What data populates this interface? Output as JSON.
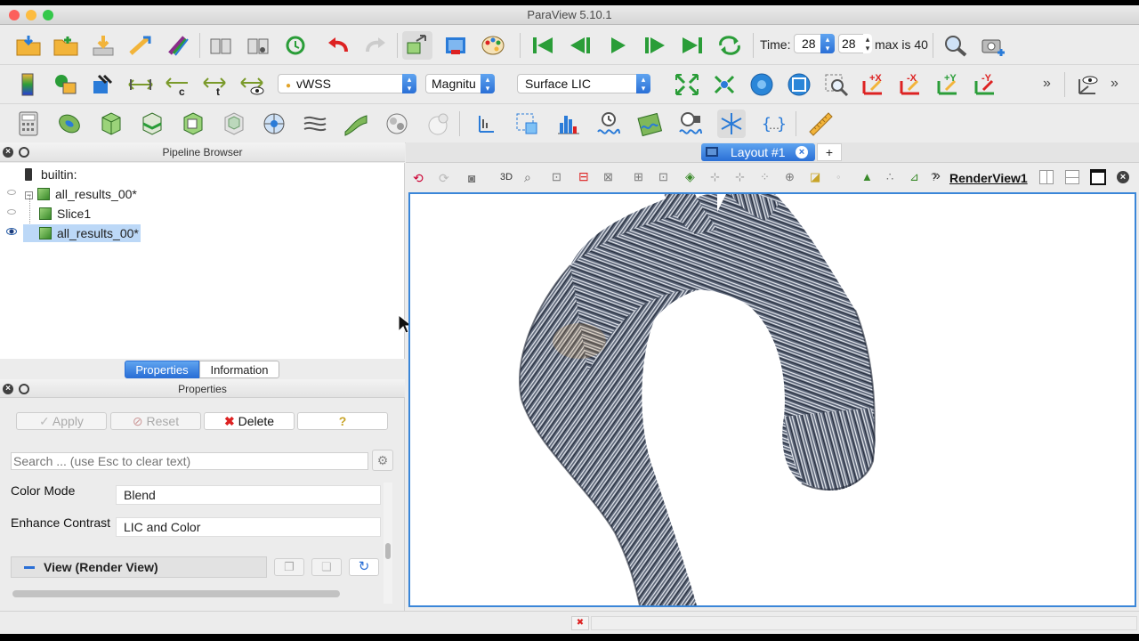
{
  "window": {
    "title": "ParaView 5.10.1"
  },
  "toolbar_top": {
    "time_label": "Time:",
    "time_value": "28",
    "time_index": "28",
    "max_label": "max is 40"
  },
  "toolbar_mid": {
    "array_select": "vWSS",
    "component_select": "Magnitu",
    "representation_select": "Surface LIC",
    "axis_labels": [
      "+X",
      "-X",
      "+Y",
      "-Y"
    ]
  },
  "pipeline": {
    "title": "Pipeline Browser",
    "items": [
      {
        "label": "builtin:"
      },
      {
        "label": "all_results_00*"
      },
      {
        "label": "Slice1"
      },
      {
        "label": "all_results_00*"
      }
    ]
  },
  "tabs": {
    "properties": "Properties",
    "information": "Information"
  },
  "properties": {
    "title": "Properties",
    "apply": "Apply",
    "reset": "Reset",
    "delete": "Delete",
    "help": "?",
    "search_placeholder": "Search ... (use Esc to clear text)",
    "color_mode_label": "Color Mode",
    "color_mode_value": "Blend",
    "enhance_contrast_label": "Enhance Contrast",
    "enhance_contrast_value": "LIC and Color",
    "section_view": "View (Render View)"
  },
  "layout": {
    "tab_label": "Layout #1",
    "add_tab": "+",
    "view_3d": "3D",
    "render_view_label": "RenderView1"
  },
  "colors": {
    "accent": "#2a7bd8",
    "selection": "#bcd8f7",
    "delete_red": "#d22"
  }
}
